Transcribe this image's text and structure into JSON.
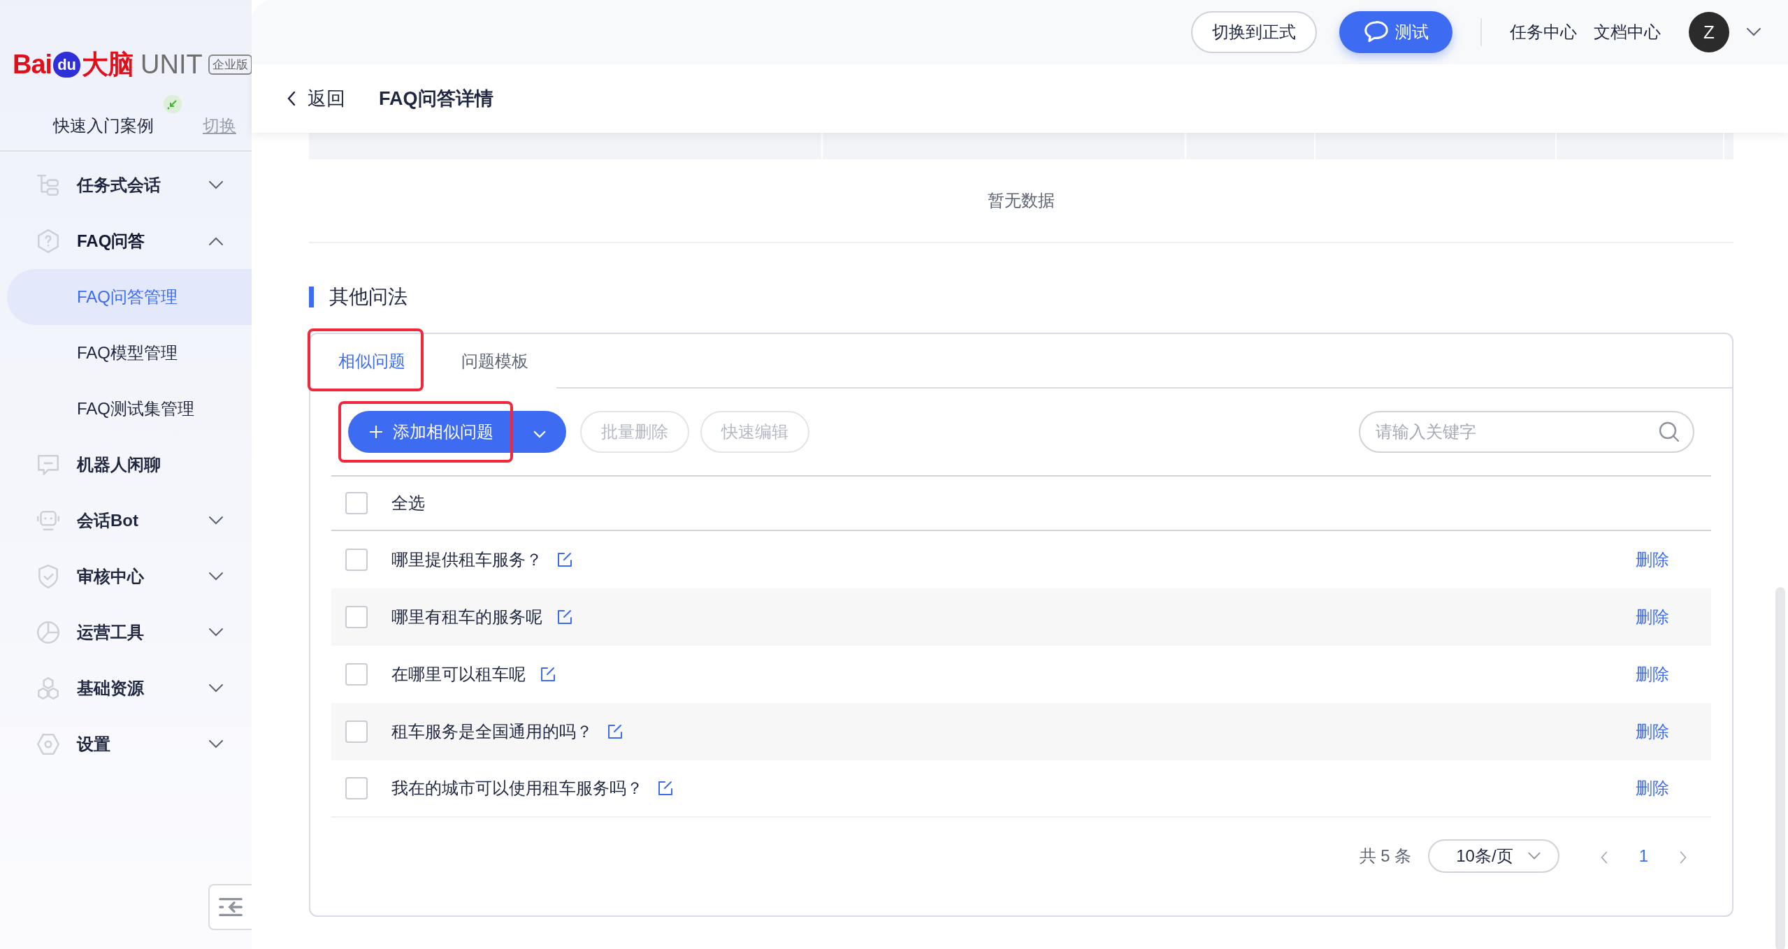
{
  "brand": {
    "logo_letters": "Bai",
    "logo_paw": "du",
    "logo_suffix": "大脑",
    "product": "UNIT",
    "edition": "企业版"
  },
  "project": {
    "name": "快速入门案例",
    "switch": "切换"
  },
  "sidebar": {
    "items": [
      {
        "label": "任务式会话",
        "expanded": false
      },
      {
        "label": "FAQ问答",
        "expanded": true,
        "children": [
          {
            "label": "FAQ问答管理",
            "selected": true
          },
          {
            "label": "FAQ模型管理",
            "selected": false
          },
          {
            "label": "FAQ测试集管理",
            "selected": false
          }
        ]
      },
      {
        "label": "机器人闲聊"
      },
      {
        "label": "会话Bot",
        "expanded": false
      },
      {
        "label": "审核中心",
        "expanded": false
      },
      {
        "label": "运营工具",
        "expanded": false
      },
      {
        "label": "基础资源",
        "expanded": false
      },
      {
        "label": "设置",
        "expanded": false
      }
    ]
  },
  "header": {
    "switch_button": "切换到正式",
    "test_button": "测试",
    "links": [
      "任务中心",
      "文档中心"
    ],
    "avatar": "Z"
  },
  "page": {
    "back": "返回",
    "title": "FAQ问答详情"
  },
  "answers_table": {
    "empty_text": "暂无数据"
  },
  "section": {
    "title": "其他问法"
  },
  "tabs": [
    {
      "label": "相似问题",
      "selected": true,
      "highlighted": true
    },
    {
      "label": "问题模板",
      "selected": false,
      "highlighted": false
    }
  ],
  "toolbar": {
    "add_button": {
      "label": "添加相似问题",
      "highlighted": true
    },
    "buttons": [
      {
        "label": "批量删除",
        "disabled": true
      },
      {
        "label": "快速编辑",
        "disabled": true
      }
    ]
  },
  "search": {
    "placeholder": "请输入关键字"
  },
  "list": {
    "select_all": {
      "label": "全选",
      "checked": false
    },
    "rows": [
      {
        "text": "哪里提供租车服务？",
        "checked": false,
        "action": "删除"
      },
      {
        "text": "哪里有租车的服务呢",
        "checked": false,
        "action": "删除"
      },
      {
        "text": "在哪里可以租车呢",
        "checked": false,
        "action": "删除"
      },
      {
        "text": "租车服务是全国通用的吗？",
        "checked": false,
        "action": "删除"
      },
      {
        "text": "我在的城市可以使用租车服务吗？",
        "checked": false,
        "action": "删除"
      }
    ]
  },
  "pagination": {
    "total": "共 5 条",
    "page_size": "10条/页",
    "pages": [
      {
        "label": "1",
        "selected": true
      }
    ]
  }
}
